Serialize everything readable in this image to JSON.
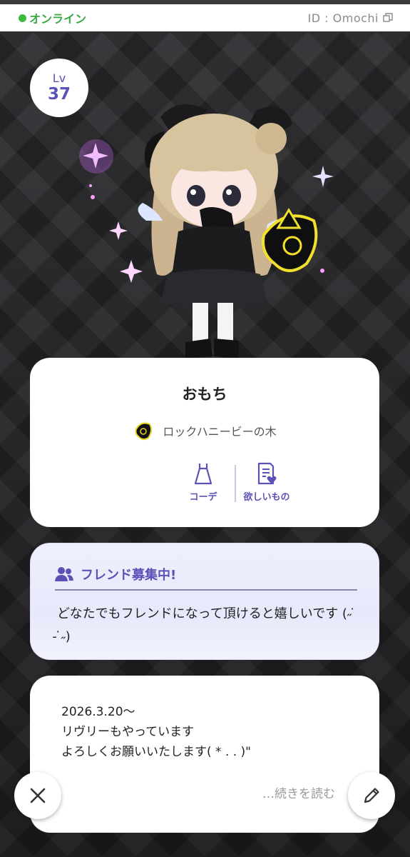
{
  "status": {
    "online_label": "オンライン",
    "id_label": "ID : Omochi",
    "online_color": "#3dbb3f"
  },
  "level": {
    "label": "Lv",
    "value": "37"
  },
  "profile": {
    "name": "おもち",
    "tree_label": "ロックハニービーの木",
    "actions": [
      {
        "label": "コーデ",
        "icon": "dress-icon"
      },
      {
        "label": "欲しいもの",
        "icon": "wishlist-icon"
      }
    ]
  },
  "friend": {
    "title": "フレンド募集中!",
    "message": "どなたでもフレンドになって頂けると嬉しいです (˶ ̇ ̵ ̇˶)",
    "accent": "#5b52b8"
  },
  "bio": {
    "lines": [
      "2026.3.20〜",
      "リヴリーもやっています",
      "よろしくお願いいたします( * . . )\""
    ],
    "read_more": "…続きを読む"
  },
  "buttons": {
    "close_icon": "close-icon",
    "edit_icon": "pencil-icon"
  }
}
